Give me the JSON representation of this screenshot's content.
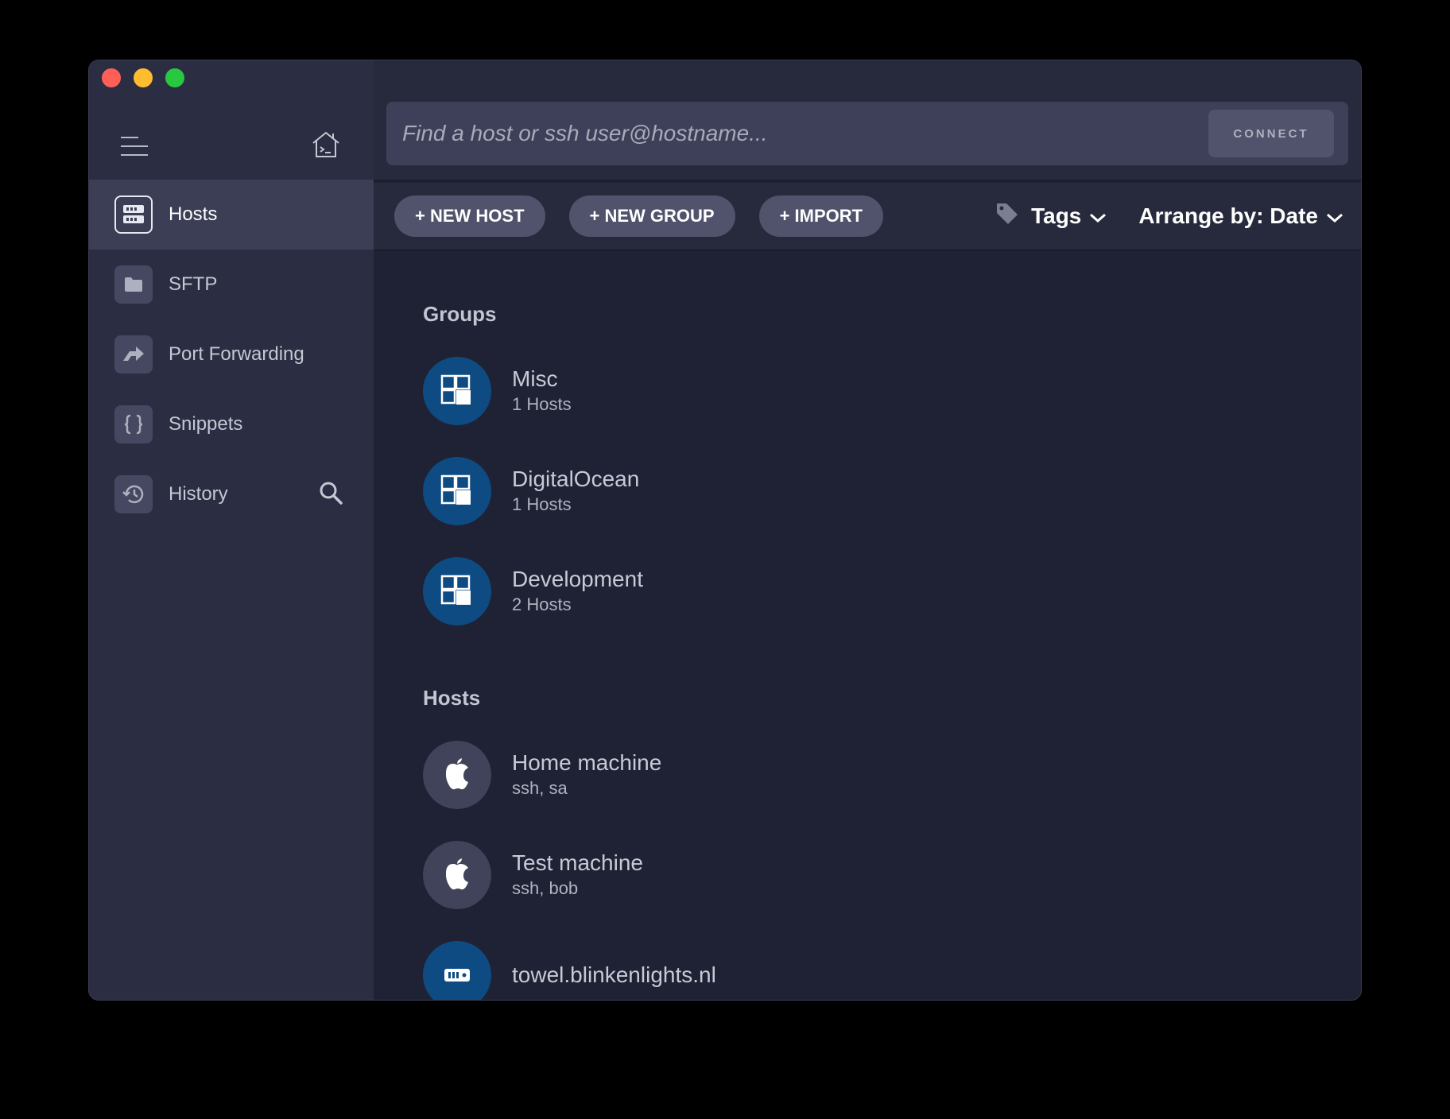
{
  "window": {
    "traffic_lights": {
      "close": "#ff5f57",
      "minimize": "#febc2e",
      "zoom": "#28c840"
    }
  },
  "sidebar": {
    "menu_icon": "hamburger-icon",
    "home_icon": "home-terminal-icon",
    "items": [
      {
        "label": "Hosts",
        "icon": "hosts-icon",
        "active": true
      },
      {
        "label": "SFTP",
        "icon": "folder-icon",
        "active": false
      },
      {
        "label": "Port Forwarding",
        "icon": "forward-icon",
        "active": false
      },
      {
        "label": "Snippets",
        "icon": "braces-icon",
        "active": false
      },
      {
        "label": "History",
        "icon": "history-icon",
        "active": false
      }
    ]
  },
  "search": {
    "placeholder": "Find a host or ssh user@hostname...",
    "value": "",
    "connect_label": "CONNECT"
  },
  "toolbar": {
    "new_host": "+ NEW HOST",
    "new_group": "+ NEW GROUP",
    "import": "+ IMPORT",
    "tags": "Tags",
    "arrange": "Arrange by: Date"
  },
  "groups": {
    "title": "Groups",
    "items": [
      {
        "name": "Misc",
        "count": "1 Hosts"
      },
      {
        "name": "DigitalOcean",
        "count": "1 Hosts"
      },
      {
        "name": "Development",
        "count": "2 Hosts"
      }
    ]
  },
  "hosts": {
    "title": "Hosts",
    "items": [
      {
        "name": "Home machine",
        "detail": "ssh, sa",
        "icon": "apple-icon"
      },
      {
        "name": "Test machine",
        "detail": "ssh, bob",
        "icon": "apple-icon"
      },
      {
        "name": "towel.blinkenlights.nl",
        "detail": "",
        "icon": "server-icon"
      }
    ]
  },
  "colors": {
    "sidebar_bg": "#2b2e42",
    "main_bg": "#1f2234",
    "group_avatar": "#0e4b82",
    "pill_bg": "#50536b"
  }
}
